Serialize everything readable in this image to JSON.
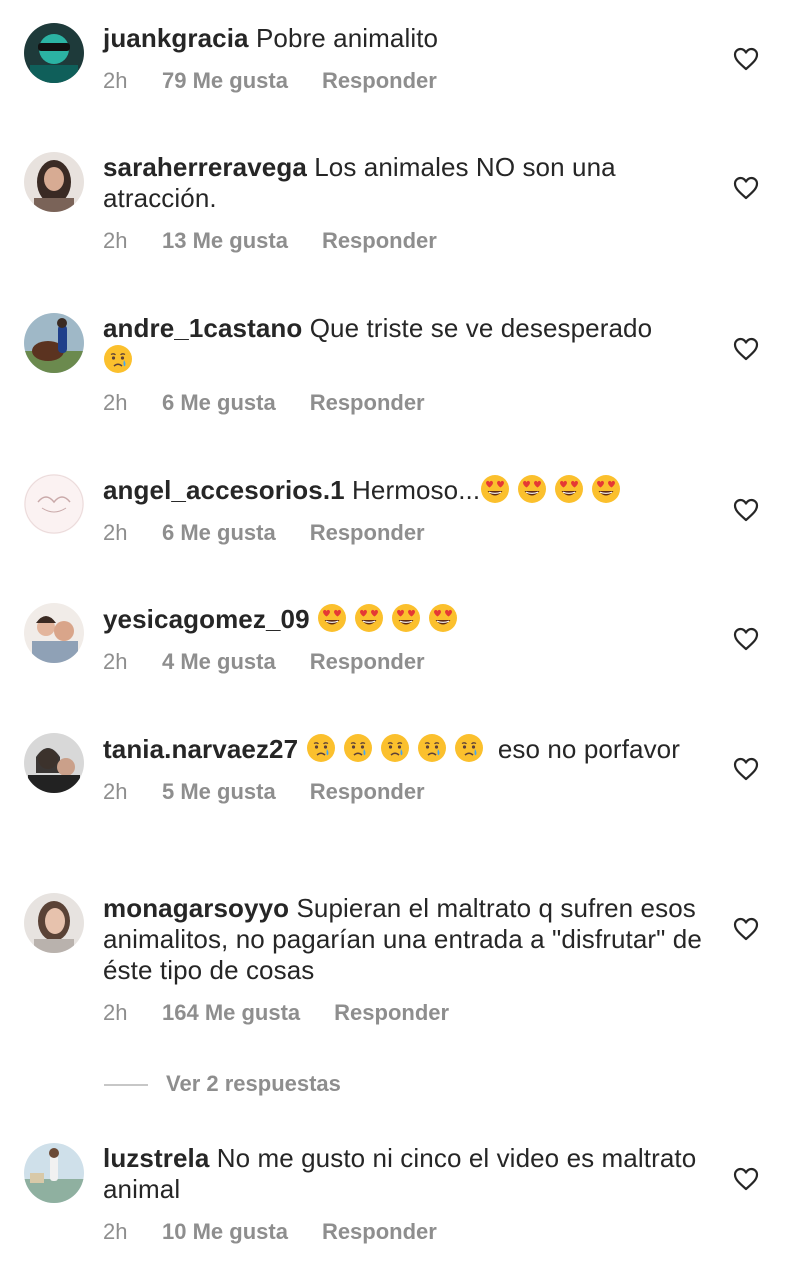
{
  "colors": {
    "text": "#262626",
    "meta": "#8e8e8e",
    "emoji_face": "#fbc02d"
  },
  "like_label": "Me gusta",
  "reply_label": "Responder",
  "view_replies": "Ver 2 respuestas",
  "comments": [
    {
      "user": "juankgracia",
      "text": "Pobre animalito",
      "time": "2h",
      "likes": "79 Me gusta"
    },
    {
      "user": "saraherreravega",
      "text": "Los animales NO son una atracción.",
      "time": "2h",
      "likes": "13 Me gusta"
    },
    {
      "user": "andre_1castano",
      "text": "Que triste se ve desesperado",
      "emoji": "crying-face",
      "emoji_count": 1,
      "time": "2h",
      "likes": "6 Me gusta"
    },
    {
      "user": "angel_accesorios.1",
      "text": "Hermoso...",
      "emoji": "heart-eyes-face",
      "emoji_count": 4,
      "time": "2h",
      "likes": "6 Me gusta"
    },
    {
      "user": "yesicagomez_09",
      "text": "",
      "emoji": "heart-eyes-face",
      "emoji_count": 4,
      "time": "2h",
      "likes": "4 Me gusta"
    },
    {
      "user": "tania.narvaez27",
      "text": "eso no porfavor",
      "emoji": "crying-face",
      "emoji_count": 5,
      "time": "2h",
      "likes": "5 Me gusta"
    },
    {
      "user": "monagarsoyyo",
      "text": "Supieran el maltrato q sufren esos animalitos, no pagarían una entrada a \"disfrutar\" de éste tipo de cosas",
      "time": "2h",
      "likes": "164 Me gusta"
    },
    {
      "user": "luzstrela",
      "text": "No me gusto ni cinco el video es maltrato animal",
      "time": "2h",
      "likes": "10 Me gusta"
    }
  ]
}
